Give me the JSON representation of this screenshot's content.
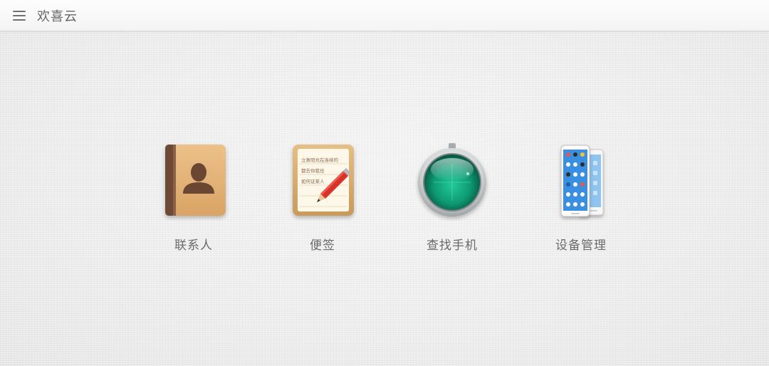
{
  "header": {
    "menu_icon": "hamburger-menu-icon",
    "title": "欢喜云"
  },
  "apps": [
    {
      "label": "联系人",
      "icon": "contacts-book-icon"
    },
    {
      "label": "便签",
      "icon": "notepad-pencil-icon"
    },
    {
      "label": "查找手机",
      "icon": "radar-find-phone-icon"
    },
    {
      "label": "设备管理",
      "icon": "phones-device-icon"
    }
  ],
  "notes_icon_text": [
    "立意阳光在连续的",
    "都去你我也",
    "如何证某人"
  ],
  "colors": {
    "contacts_cover": "#e2b174",
    "contacts_spine": "#6e4a35",
    "radar_green": "#10a07a",
    "device_screen": "#3a8fe0"
  }
}
